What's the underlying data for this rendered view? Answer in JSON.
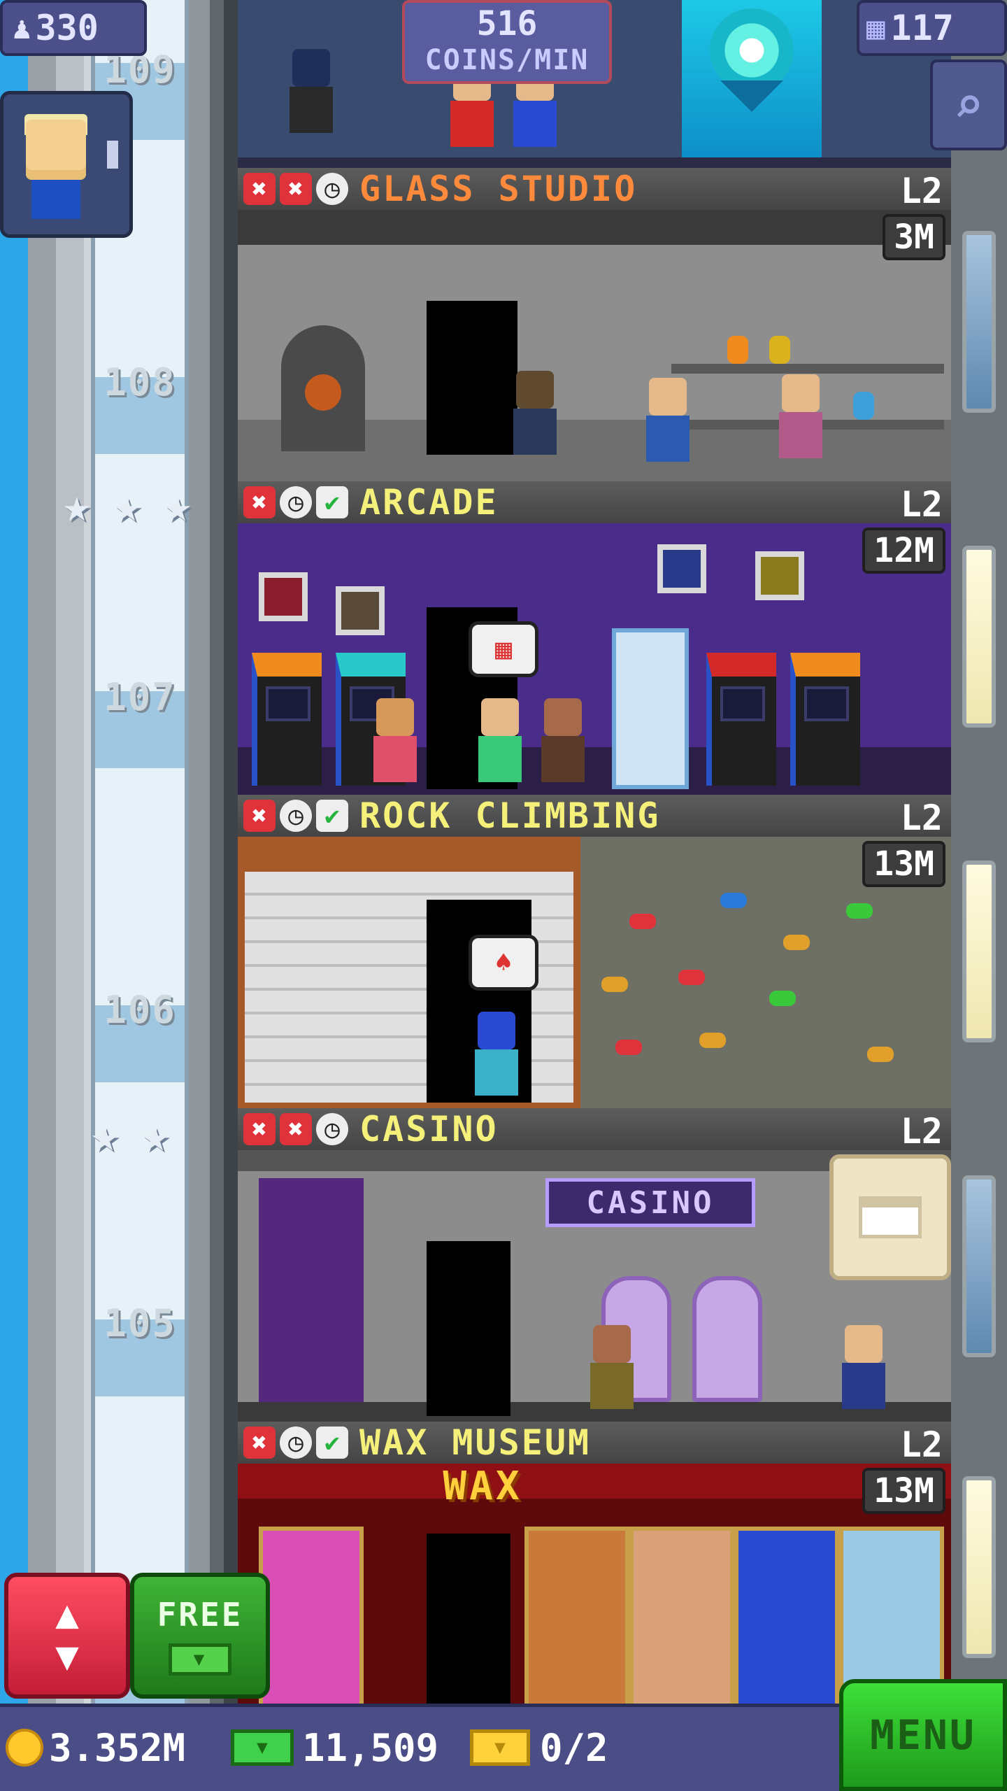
{
  "hud": {
    "population": "330",
    "coins_per_min_value": "516",
    "coins_per_min_label": "COINS/MIN",
    "bux_floors": "117"
  },
  "tower": {
    "floor_numbers": [
      "109",
      "108",
      "107",
      "106",
      "105"
    ]
  },
  "floors": [
    {
      "name": "GLASS STUDIO",
      "level": "L2",
      "timer": "3M",
      "name_color": "#ff8a3c",
      "status": [
        "x",
        "x",
        "clock"
      ]
    },
    {
      "name": "ARCADE",
      "level": "L2",
      "timer": "12M",
      "name_color": "#f5f07a",
      "status": [
        "x",
        "clock",
        "check"
      ]
    },
    {
      "name": "ROCK CLIMBING",
      "level": "L2",
      "timer": "13M",
      "name_color": "#f5f07a",
      "status": [
        "x",
        "clock",
        "check"
      ]
    },
    {
      "name": "CASINO",
      "level": "L2",
      "timer": "",
      "name_color": "#f5f07a",
      "status": [
        "x",
        "x",
        "clock"
      ],
      "sign": "CASINO"
    },
    {
      "name": "WAX MUSEUM",
      "level": "L2",
      "timer": "13M",
      "name_color": "#f5f07a",
      "status": [
        "x",
        "clock",
        "check"
      ],
      "sign": "WAX"
    }
  ],
  "bottom": {
    "free_label": "FREE",
    "coins": "3.352M",
    "bux": "11,509",
    "tickets": "0/2",
    "menu_label": "MENU"
  },
  "icons": {
    "population": "person-icon",
    "bux_floors": "building-icon",
    "search": "magnifier-icon",
    "elevator": "up-down-arrows-icon",
    "coin": "coin-icon",
    "bux": "bux-bill-icon",
    "ticket": "vip-ticket-icon"
  },
  "colors": {
    "hud_pill": "#4b4f8a",
    "menu_green": "#3ee03a",
    "elevator_red": "#ff4d62",
    "status_red": "#e0323a"
  }
}
